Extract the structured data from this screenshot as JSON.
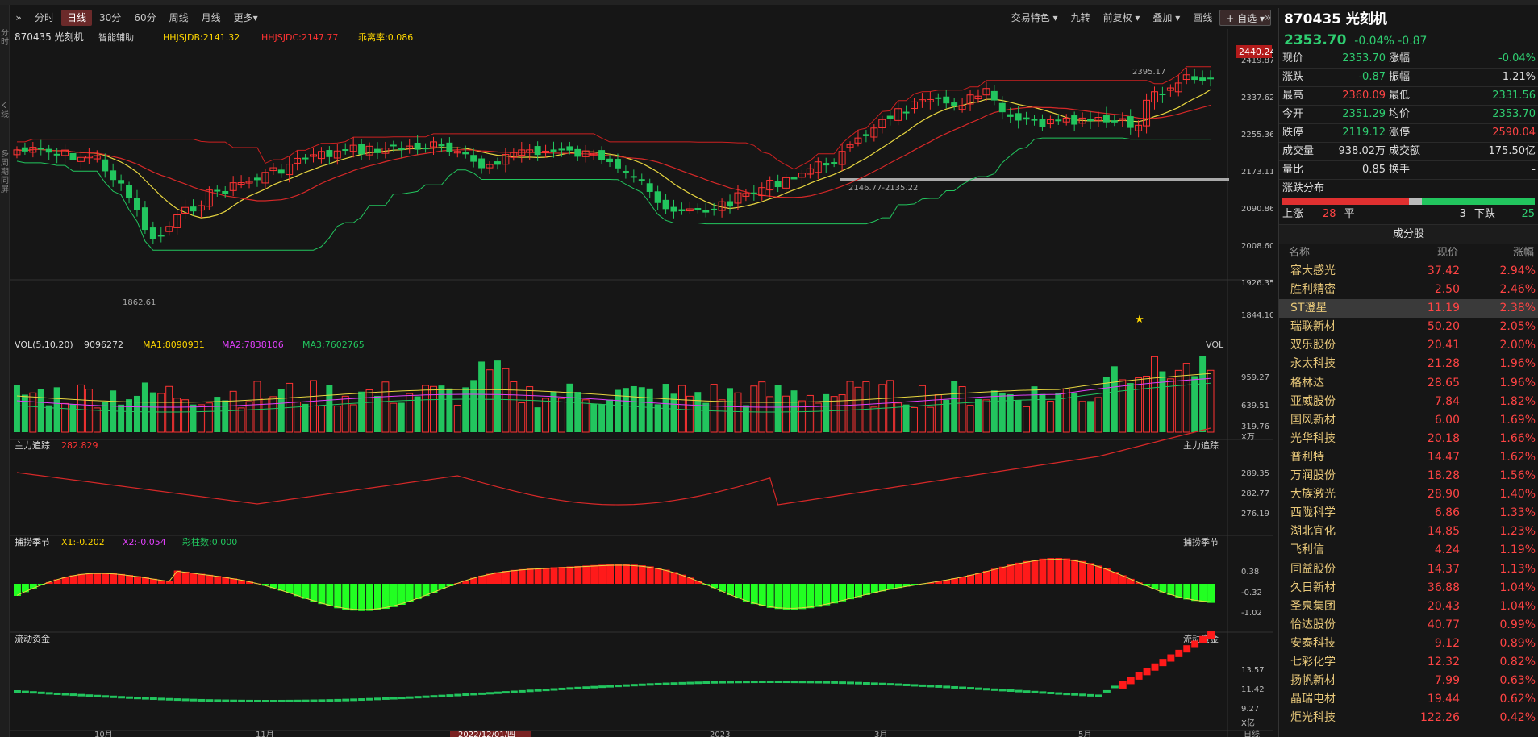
{
  "toolbar": {
    "expand": "»",
    "periods": [
      "分时",
      "日线",
      "30分",
      "60分",
      "周线",
      "月线",
      "更多▾"
    ],
    "active": "日线",
    "right": [
      "交易特色 ▾",
      "九转",
      "前复权 ▾",
      "叠加 ▾",
      "画线"
    ],
    "zixuan": "+ 自选 ▾"
  },
  "left_strip": [
    "分时",
    "K线",
    "多周期同屏"
  ],
  "main_chart": {
    "stock": "870435 光刻机",
    "assist": "智能辅助",
    "ind1": "HHJSJDB:2141.32",
    "ind2": "HHJSJDC:2147.77",
    "ind3": "乖离率:0.086",
    "y_ticks": [
      "2419.87",
      "2337.62",
      "2255.36",
      "2173.11",
      "2090.86",
      "2008.60",
      "1926.35",
      "1844.10"
    ],
    "price_box": "2440.24",
    "hi_label": "2395.17",
    "lo_label": "1862.61",
    "range_label": "2146.77-2135.22"
  },
  "vol_chart": {
    "title": "VOL(5,10,20)",
    "value": "9096272",
    "ma1": "MA1:8090931",
    "ma2": "MA2:7838106",
    "ma3": "MA3:7602765",
    "right": "VOL",
    "y_ticks": [
      "959.27",
      "639.51",
      "319.76"
    ],
    "unit": "X万"
  },
  "zl_chart": {
    "title": "主力追踪",
    "value": "282.829",
    "right": "主力追踪",
    "y_ticks": [
      "289.35",
      "282.77",
      "276.19"
    ]
  },
  "bl_chart": {
    "title": "捕捞季节",
    "x1": "X1:-0.202",
    "x2": "X2:-0.054",
    "cz": "彩柱数:0.000",
    "right": "捕捞季节",
    "y_ticks": [
      "0.38",
      "-0.32",
      "-1.02"
    ]
  },
  "ld_chart": {
    "title": "流动资金",
    "right": "流动资金",
    "y_ticks": [
      "13.57",
      "11.42",
      "9.27"
    ],
    "unit": "X亿"
  },
  "x_axis": {
    "labels": [
      "10月",
      "11月",
      "2022/12/01/四",
      "2023",
      "3月",
      "5月"
    ],
    "right": "日线"
  },
  "colors": {
    "up": "#ff3333",
    "down": "#22c55e",
    "bg": "#161616",
    "ma_yellow": "#e8d640",
    "ma_red": "#d62828"
  },
  "right_panel": {
    "title": "870435 光刻机",
    "price": "2353.70",
    "change": "-0.04% -0.87",
    "quote": [
      {
        "k1": "现价",
        "v1": "2353.70",
        "c1": "grn",
        "k2": "涨幅",
        "v2": "-0.04%",
        "c2": "grn"
      },
      {
        "k1": "涨跌",
        "v1": "-0.87",
        "c1": "grn",
        "k2": "振幅",
        "v2": "1.21%",
        "c2": "wht"
      },
      {
        "k1": "最高",
        "v1": "2360.09",
        "c1": "red",
        "k2": "最低",
        "v2": "2331.56",
        "c2": "grn"
      },
      {
        "k1": "今开",
        "v1": "2351.29",
        "c1": "grn",
        "k2": "均价",
        "v2": "2353.70",
        "c2": "grn"
      },
      {
        "k1": "跌停",
        "v1": "2119.12",
        "c1": "grn",
        "k2": "涨停",
        "v2": "2590.04",
        "c2": "red"
      },
      {
        "k1": "成交量",
        "v1": "938.02万",
        "c1": "wht",
        "k2": "成交额",
        "v2": "175.50亿",
        "c2": "wht"
      },
      {
        "k1": "量比",
        "v1": "0.85",
        "c1": "wht",
        "k2": "换手",
        "v2": "-",
        "c2": "wht"
      }
    ],
    "dist_title": "涨跌分布",
    "up_label": "上涨",
    "up_count": "28",
    "flat_label": "平",
    "flat_count": "3",
    "down_label": "下跌",
    "down_count": "25",
    "up_frac": 0.5,
    "flat_frac": 0.054,
    "cf_title": "成分股",
    "cf_headers": [
      "名称",
      "现价",
      "涨幅"
    ],
    "stocks": [
      {
        "name": "容大感光",
        "price": "37.42",
        "pct": "2.94%"
      },
      {
        "name": "胜利精密",
        "price": "2.50",
        "pct": "2.46%"
      },
      {
        "name": "ST澄星",
        "price": "11.19",
        "pct": "2.38%"
      },
      {
        "name": "瑞联新材",
        "price": "50.20",
        "pct": "2.05%"
      },
      {
        "name": "双乐股份",
        "price": "20.41",
        "pct": "2.00%"
      },
      {
        "name": "永太科技",
        "price": "21.28",
        "pct": "1.96%"
      },
      {
        "name": "格林达",
        "price": "28.65",
        "pct": "1.96%"
      },
      {
        "name": "亚威股份",
        "price": "7.84",
        "pct": "1.82%"
      },
      {
        "name": "国风新材",
        "price": "6.00",
        "pct": "1.69%"
      },
      {
        "name": "光华科技",
        "price": "20.18",
        "pct": "1.66%"
      },
      {
        "name": "普利特",
        "price": "14.47",
        "pct": "1.62%"
      },
      {
        "name": "万润股份",
        "price": "18.28",
        "pct": "1.56%"
      },
      {
        "name": "大族激光",
        "price": "28.90",
        "pct": "1.40%"
      },
      {
        "name": "西陇科学",
        "price": "6.86",
        "pct": "1.33%"
      },
      {
        "name": "湖北宜化",
        "price": "14.85",
        "pct": "1.23%"
      },
      {
        "name": "飞利信",
        "price": "4.24",
        "pct": "1.19%"
      },
      {
        "name": "同益股份",
        "price": "14.37",
        "pct": "1.13%"
      },
      {
        "name": "久日新材",
        "price": "36.88",
        "pct": "1.04%"
      },
      {
        "name": "圣泉集团",
        "price": "20.43",
        "pct": "1.04%"
      },
      {
        "name": "怡达股份",
        "price": "40.77",
        "pct": "0.99%"
      },
      {
        "name": "安泰科技",
        "price": "9.12",
        "pct": "0.89%"
      },
      {
        "name": "七彩化学",
        "price": "12.32",
        "pct": "0.82%"
      },
      {
        "name": "扬帆新材",
        "price": "7.99",
        "pct": "0.63%"
      },
      {
        "name": "晶瑞电材",
        "price": "19.44",
        "pct": "0.62%"
      },
      {
        "name": "炬光科技",
        "price": "122.26",
        "pct": "0.42%"
      }
    ]
  }
}
